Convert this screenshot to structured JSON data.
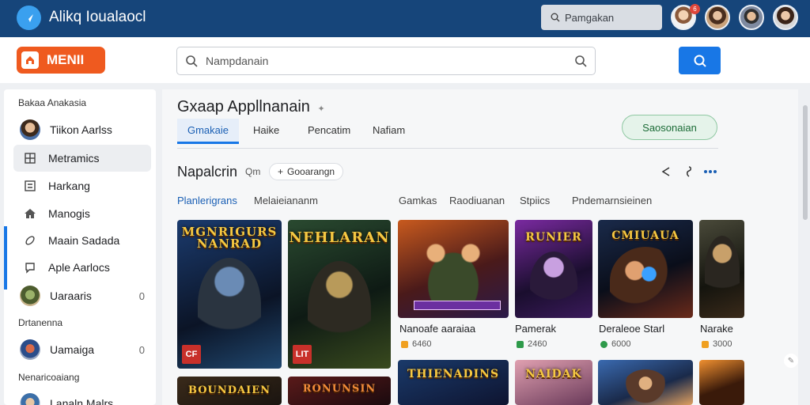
{
  "app": {
    "title": "Alikq Ioualaocl"
  },
  "topbar": {
    "search_label": "Pamgakan",
    "notification_count": "6"
  },
  "header": {
    "menu_label": "MENII",
    "search_placeholder": "Nampdanain"
  },
  "sidebar": {
    "heading": "Bakaa Anakasia",
    "items": [
      {
        "label": "Tiikon Aarlss",
        "icon": "user-avatar"
      },
      {
        "label": "Metramics",
        "icon": "grid-icon"
      },
      {
        "label": "Harkang",
        "icon": "list-icon"
      },
      {
        "label": "Manogis",
        "icon": "home-icon"
      },
      {
        "label": "Maain Sadada",
        "icon": "leaf-icon"
      },
      {
        "label": "Aple Aarlocs",
        "icon": "chat-icon"
      },
      {
        "label": "Uaraaris",
        "icon": "user-avatar",
        "count": "0"
      }
    ],
    "section2": "Drtanenna",
    "items2": [
      {
        "label": "Uamaiga",
        "icon": "user-avatar",
        "count": "0"
      }
    ],
    "section3": "Nenaricoaiang",
    "items3": [
      {
        "label": "Lanaln Malrs",
        "icon": "user-avatar"
      }
    ]
  },
  "main": {
    "title": "Gxaap Appllnanain",
    "tabs": [
      {
        "label": "Gmakaie",
        "active": true
      },
      {
        "label": "Haike"
      },
      {
        "label": "Pencatim"
      },
      {
        "label": "Nafiam"
      }
    ],
    "suggest_button": "Saosonaian",
    "section_title": "Napalcrin",
    "section_sub": "Qm",
    "chip": "Gooarangn",
    "filters": [
      {
        "label": "Planlerigrans",
        "active": true
      },
      {
        "label": "Melaieiananm"
      },
      {
        "label": "Gamkas"
      },
      {
        "label": "Raodiuanan"
      },
      {
        "label": "Stpiics"
      },
      {
        "label": "Pndemarnsieinen"
      }
    ]
  },
  "cards_row1": [
    {
      "cover": "MGNRIGURS NANRAD",
      "corner": "CF"
    },
    {
      "cover": "NEHLARAN",
      "corner": "LIT"
    },
    {
      "name": "Nanoafe aaraiaa",
      "rating": "6460"
    },
    {
      "cover": "RUNIER",
      "name": "Pamerak",
      "rating": "2460"
    },
    {
      "cover": "CMIUAUA",
      "name": "Deraleoe Starl",
      "rating": "6000"
    },
    {
      "name": "Narake",
      "rating": "3000"
    }
  ],
  "cards_row2": [
    {
      "cover": "BOUNDAIEN"
    },
    {
      "cover": "RONUNSIN"
    },
    {
      "cover": "THIENADINS"
    },
    {
      "cover": "NAIDAK"
    },
    {
      "cover": ""
    },
    {
      "cover": ""
    }
  ],
  "colors": {
    "topbar": "#16457a",
    "accent": "#1877e6",
    "menu": "#ef5a1f"
  }
}
